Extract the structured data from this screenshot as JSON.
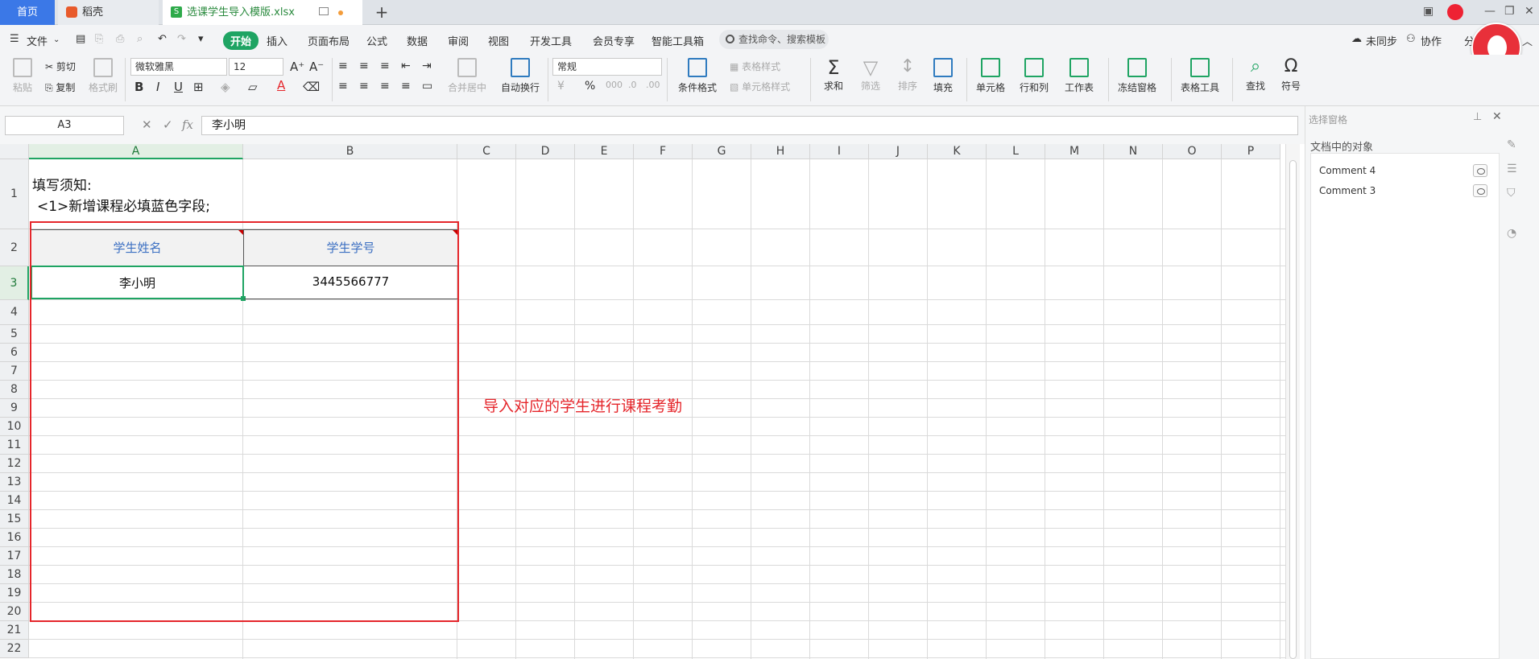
{
  "tabs": {
    "home": "首页",
    "daoke": "稻壳",
    "file": "选课学生导入模版.xlsx",
    "file_icon": "S"
  },
  "menu": {
    "file": "文件",
    "items": [
      "开始",
      "插入",
      "页面布局",
      "公式",
      "数据",
      "审阅",
      "视图",
      "开发工具",
      "会员专享",
      "智能工具箱"
    ],
    "search": "查找命令、搜索模板",
    "sync": "未同步",
    "collab": "协作",
    "share": "分"
  },
  "ribbon": {
    "paste": "粘贴",
    "cut": "剪切",
    "copy": "复制",
    "format_painter": "格式刷",
    "font_name": "微软雅黑",
    "font_size": "12",
    "bold": "B",
    "italic": "I",
    "underline": "U",
    "font_color": "A",
    "merge": "合并居中",
    "wrap": "自动换行",
    "number_format": "常规",
    "percent": "%",
    "cond_format": "条件格式",
    "table_style": "表格样式",
    "cell_style": "单元格样式",
    "sum": "求和",
    "filter": "筛选",
    "sort": "排序",
    "fill": "填充",
    "cell": "单元格",
    "row_col": "行和列",
    "sheet": "工作表",
    "freeze": "冻结窗格",
    "table_tools": "表格工具",
    "find": "查找",
    "symbol": "符号"
  },
  "formula_bar": {
    "cell_ref": "A3",
    "fx": "fx",
    "content": "李小明"
  },
  "grid": {
    "columns": [
      "A",
      "B",
      "C",
      "D",
      "E",
      "F",
      "G",
      "H",
      "I",
      "J",
      "K",
      "L",
      "M",
      "N",
      "O",
      "P"
    ],
    "rows": [
      "1",
      "2",
      "3",
      "4",
      "5",
      "6",
      "7",
      "8",
      "9",
      "10",
      "11",
      "12",
      "13",
      "14",
      "15",
      "16",
      "17",
      "18",
      "19",
      "20",
      "21",
      "22"
    ],
    "a1_line1": "填写须知:",
    "a1_line2": "<1>新增课程必填蓝色字段;",
    "header_name": "学生姓名",
    "header_id": "学生学号",
    "a3": "李小明",
    "b3": "3445566777",
    "note": "导入对应的学生进行课程考勤"
  },
  "side_panel": {
    "title": "选择窗格",
    "section": "文档中的对象",
    "objects": [
      "Comment 4",
      "Comment 3"
    ]
  },
  "colors": {
    "accent": "#1fa463",
    "red": "#e5262b",
    "blue_header": "#3b6fc2"
  }
}
